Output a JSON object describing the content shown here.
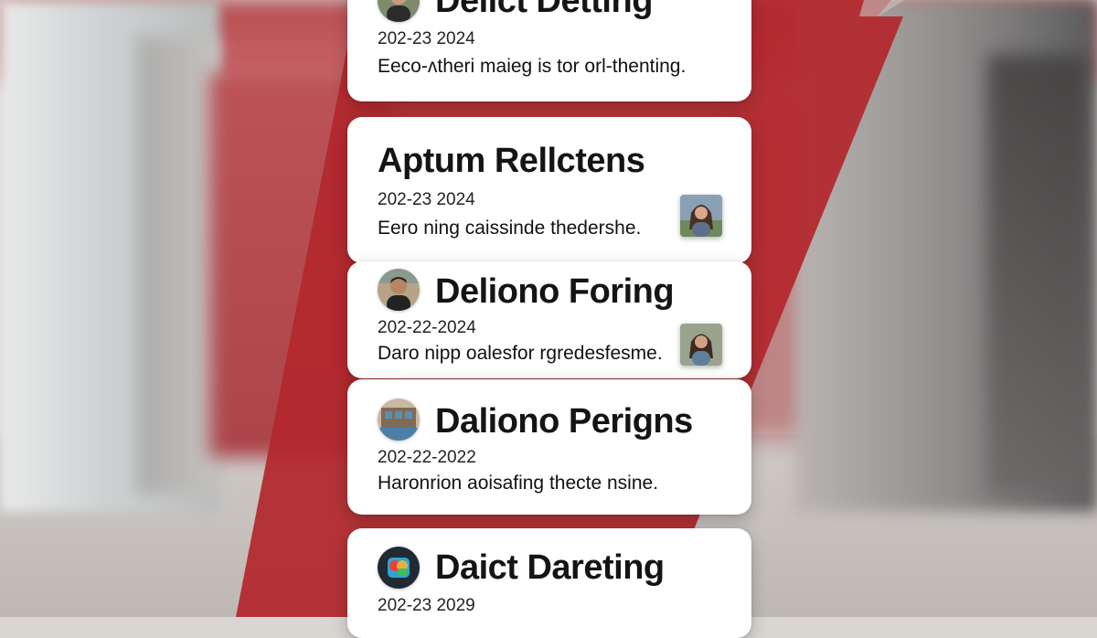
{
  "colors": {
    "accent_red": "#b3282d",
    "card_bg": "#ffffff",
    "text": "#141414"
  },
  "feed": {
    "items": [
      {
        "title": "Delict Detting",
        "date": "202-23 2024",
        "description": "Eeco-ʌtheri maieg is tor orl-thenting.",
        "avatar_icon": "person-avatar-icon"
      },
      {
        "title": "Aptum Rellctens",
        "date": "202-23 2024",
        "description": "Eero ning caissinde thedershe.",
        "thumbnail_icon": "woman-photo-thumbnail-icon"
      },
      {
        "title": "Deliono Foring",
        "date": "202-22-2024",
        "description": "Daro nipp oalesfor rgredesfesme.",
        "avatar_icon": "person-avatar-icon",
        "thumbnail_icon": "woman-photo-thumbnail-icon"
      },
      {
        "title": "Daliono Perigns",
        "date": "202-22-2022",
        "description": "Haronrion aoisafing thecte nsine.",
        "avatar_icon": "building-avatar-icon"
      },
      {
        "title": "Daict Dareting",
        "date": "202-23 2029",
        "description": "",
        "avatar_icon": "app-logo-avatar-icon"
      }
    ]
  }
}
